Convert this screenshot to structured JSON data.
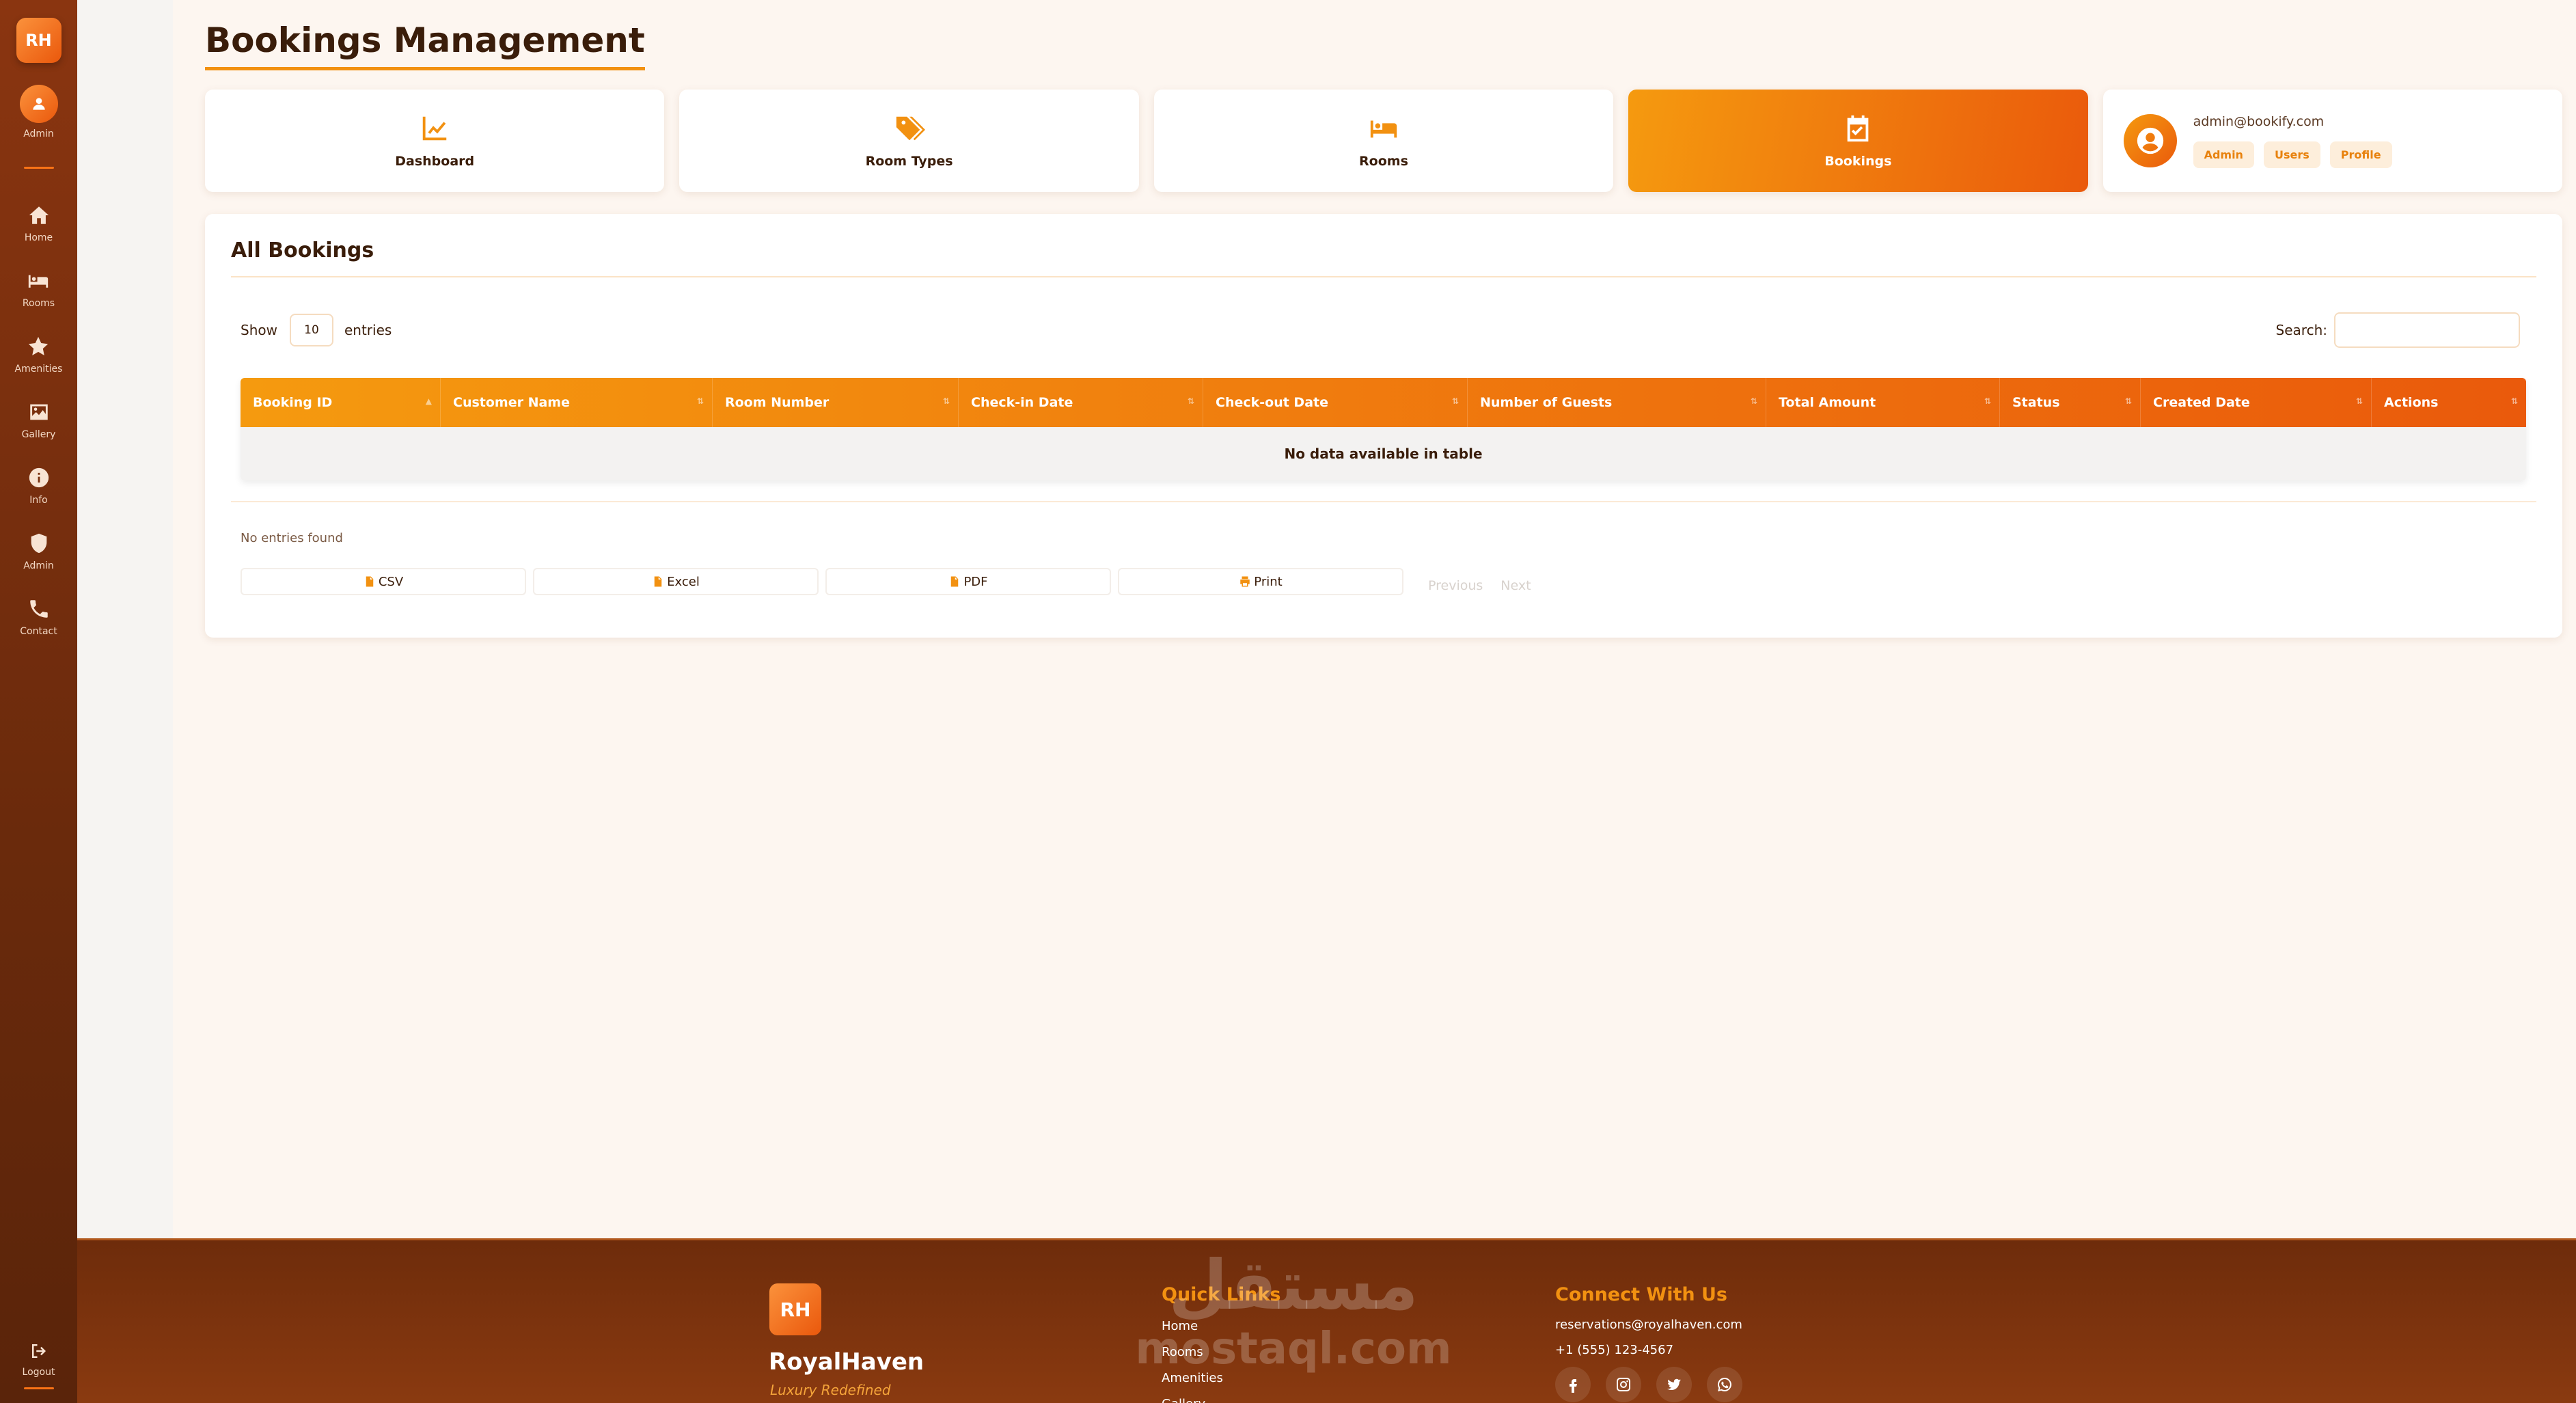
{
  "sidebar": {
    "logo": "RH",
    "user_label": "Admin",
    "items": [
      {
        "label": "Home",
        "icon": "home-icon"
      },
      {
        "label": "Rooms",
        "icon": "bed-icon"
      },
      {
        "label": "Amenities",
        "icon": "star-icon"
      },
      {
        "label": "Gallery",
        "icon": "image-icon"
      },
      {
        "label": "Info",
        "icon": "info-icon"
      },
      {
        "label": "Admin",
        "icon": "shield-icon"
      },
      {
        "label": "Contact",
        "icon": "phone-icon"
      }
    ],
    "logout_label": "Logout"
  },
  "page": {
    "title": "Bookings Management"
  },
  "nav_cards": [
    {
      "label": "Dashboard",
      "icon": "chart-line-icon"
    },
    {
      "label": "Room Types",
      "icon": "tags-icon"
    },
    {
      "label": "Rooms",
      "icon": "bed-icon"
    },
    {
      "label": "Bookings",
      "icon": "calendar-check-icon",
      "active": true
    }
  ],
  "user_card": {
    "email": "admin@bookify.com",
    "pills": [
      "Admin",
      "Users",
      "Profile"
    ]
  },
  "bookings": {
    "title": "All Bookings",
    "length": {
      "prefix": "Show",
      "value": "10",
      "suffix": "entries"
    },
    "search": {
      "label": "Search:",
      "value": ""
    },
    "columns": [
      "Booking ID",
      "Customer Name",
      "Room Number",
      "Check-in Date",
      "Check-out Date",
      "Number of Guests",
      "Total Amount",
      "Status",
      "Created Date",
      "Actions"
    ],
    "empty_message": "No data available in table",
    "info": "No entries found",
    "export_buttons": [
      {
        "label": "CSV",
        "icon": "file-csv-icon"
      },
      {
        "label": "Excel",
        "icon": "file-excel-icon"
      },
      {
        "label": "PDF",
        "icon": "file-pdf-icon"
      },
      {
        "label": "Print",
        "icon": "print-icon"
      }
    ],
    "pagination": {
      "previous": "Previous",
      "next": "Next"
    }
  },
  "footer": {
    "logo": "RH",
    "brand": "RoyalHaven",
    "tagline": "Luxury Redefined",
    "quick_links_title": "Quick Links",
    "quick_links": [
      "Home",
      "Rooms",
      "Amenities",
      "Gallery"
    ],
    "connect_title": "Connect With Us",
    "email": "reservations@royalhaven.com",
    "phone": "+1 (555) 123-4567",
    "social": [
      "facebook-icon",
      "instagram-icon",
      "twitter-icon",
      "whatsapp-icon"
    ],
    "watermark_arabic": "مستقل",
    "watermark_latin": "mostaql.com"
  },
  "colors": {
    "accent": "#f29111",
    "accent_dark": "#ea5a0c",
    "sidebar": "#6a2a0c",
    "background": "#fdf6f0"
  }
}
